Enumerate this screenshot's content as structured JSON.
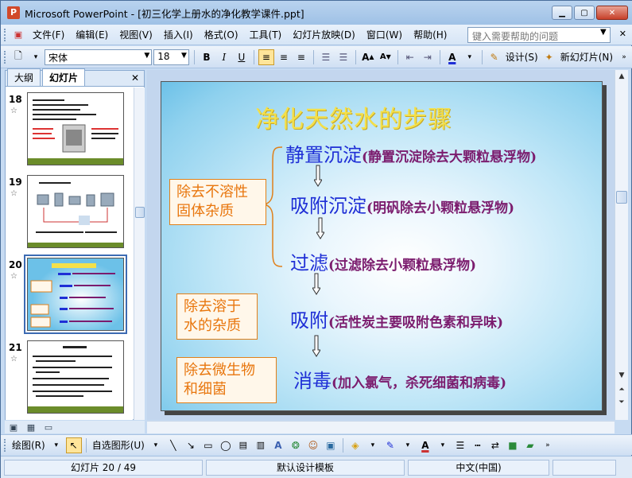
{
  "window": {
    "app_name": "Microsoft PowerPoint",
    "title": "Microsoft PowerPoint - [初三化学上册水的净化教学课件.ppt]"
  },
  "menu": {
    "items": [
      "文件(F)",
      "编辑(E)",
      "视图(V)",
      "插入(I)",
      "格式(O)",
      "工具(T)",
      "幻灯片放映(D)",
      "窗口(W)",
      "帮助(H)"
    ],
    "help_placeholder": "键入需要帮助的问题"
  },
  "toolbar": {
    "font_name": "宋体",
    "font_size": "18",
    "bold": "B",
    "italic": "I",
    "underline": "U",
    "design_label": "设计(S)",
    "new_slide_label": "新幻灯片(N)"
  },
  "panel": {
    "tabs": [
      "大纲",
      "幻灯片"
    ],
    "selected_tab": "幻灯片",
    "thumbnails": [
      {
        "number": "18",
        "star": "☆"
      },
      {
        "number": "19",
        "star": "☆"
      },
      {
        "number": "20",
        "star": "☆",
        "selected": true
      },
      {
        "number": "21",
        "star": "☆"
      }
    ]
  },
  "slide": {
    "title": "净化天然水的步骤",
    "steps": [
      {
        "main": "静置沉淀",
        "detail": "(静置沉淀除去大颗粒悬浮物)"
      },
      {
        "main": "吸附沉淀",
        "detail": "(明矾除去小颗粒悬浮物)"
      },
      {
        "main": "过滤",
        "detail": "(过滤除去小颗粒悬浮物)"
      },
      {
        "main": "吸附",
        "detail": "(活性炭主要吸附色素和异味)"
      },
      {
        "main": "消毒",
        "detail": "(加入氯气，杀死细菌和病毒)"
      }
    ],
    "boxes": [
      {
        "line1": "除去不溶性",
        "line2": "固体杂质"
      },
      {
        "line1": "除去溶于",
        "line2": "水的杂质"
      },
      {
        "line1": "除去微生物",
        "line2": "和细菌"
      }
    ],
    "colors": {
      "title": "#f4e04a",
      "step_main": "#1f2fd6",
      "step_detail": "#7b1c6e",
      "box_border": "#e0801a",
      "box_text": "#e8760d"
    }
  },
  "drawbar": {
    "draw_label": "绘图(R)",
    "autoshape_label": "自选图形(U)"
  },
  "status": {
    "slide_info": "幻灯片 20 / 49",
    "template": "默认设计模板",
    "language": "中文(中国)"
  }
}
